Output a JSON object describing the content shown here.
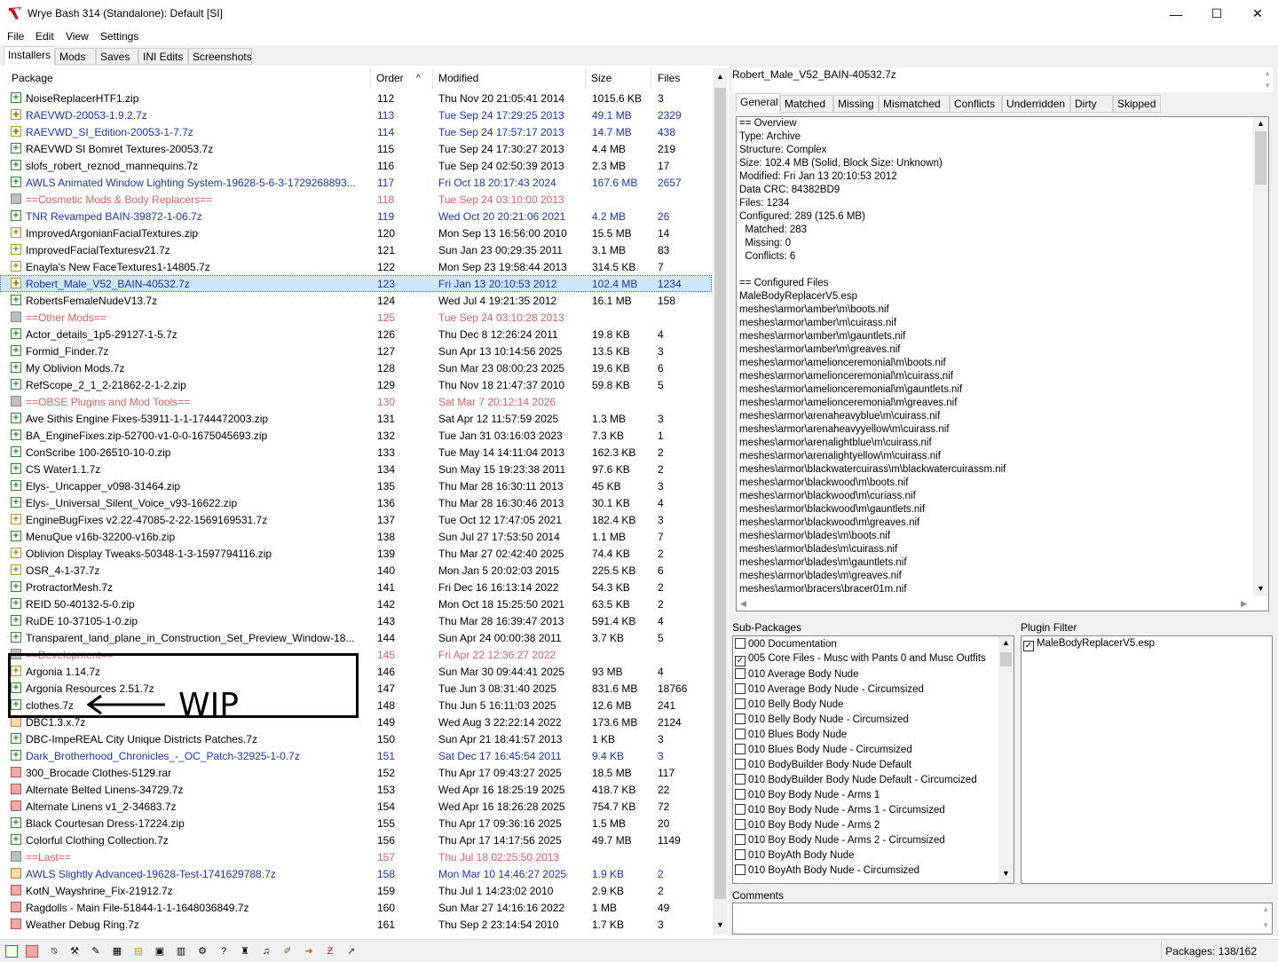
{
  "window": {
    "title": "Wrye Bash 314 (Standalone): Default [SI]",
    "minimize": "—",
    "maximize": "☐",
    "close": "✕"
  },
  "menu": [
    "File",
    "Edit",
    "View",
    "Settings"
  ],
  "tabs": [
    "Installers",
    "Mods",
    "Saves",
    "INI Edits",
    "Screenshots"
  ],
  "columns": {
    "package": "Package",
    "order": "Order",
    "modified": "Modified",
    "size": "Size",
    "files": "Files",
    "sort_arrow": "^"
  },
  "packages": [
    {
      "name": "NoiseReplacerHTF1.zip",
      "order": "112",
      "modified": "Thu Nov 20 21:05:41 2014",
      "size": "1015.6 KB",
      "files": "3",
      "icon": "green",
      "style": ""
    },
    {
      "name": "RAEVWD-20053-1.9.2.7z",
      "order": "113",
      "modified": "Tue Sep 24 17:29:25 2013",
      "size": "49.1 MB",
      "files": "2329",
      "icon": "yellowx",
      "style": "blue"
    },
    {
      "name": "RAEVWD_SI_Edition-20053-1-7.7z",
      "order": "114",
      "modified": "Tue Sep 24 17:57:17 2013",
      "size": "14.7 MB",
      "files": "438",
      "icon": "yellowx",
      "style": "blue"
    },
    {
      "name": "RAEVWD SI Bomret Textures-20053.7z",
      "order": "115",
      "modified": "Tue Sep 24 17:30:27 2013",
      "size": "4.4 MB",
      "files": "219",
      "icon": "green",
      "style": ""
    },
    {
      "name": "slofs_robert_reznod_mannequins.7z",
      "order": "116",
      "modified": "Tue Sep 24 02:50:39 2013",
      "size": "2.3 MB",
      "files": "17",
      "icon": "green",
      "style": ""
    },
    {
      "name": "AWLS Animated Window Lighting System-19628-5-6-3-1729268893...",
      "order": "117",
      "modified": "Fri Oct 18 20:17:43 2024",
      "size": "167.6 MB",
      "files": "2657",
      "icon": "green",
      "style": "blue"
    },
    {
      "name": "==Cosmetic Mods & Body Replacers==",
      "order": "118",
      "modified": "Tue Sep 24 03:10:00 2013",
      "size": "",
      "files": "",
      "icon": "gray",
      "style": "redt"
    },
    {
      "name": "TNR Revamped BAIN-39872-1-06.7z",
      "order": "119",
      "modified": "Wed Oct 20 20:21:06 2021",
      "size": "4.2 MB",
      "files": "26",
      "icon": "green",
      "style": "blue"
    },
    {
      "name": "ImprovedArgonianFacialTextures.zip",
      "order": "120",
      "modified": "Mon Sep 13 16:56:00 2010",
      "size": "15.5 MB",
      "files": "14",
      "icon": "yellow",
      "style": ""
    },
    {
      "name": "ImprovedFacialTexturesv21.7z",
      "order": "121",
      "modified": "Sun Jan 23 00:29:35 2011",
      "size": "3.1 MB",
      "files": "83",
      "icon": "yellow",
      "style": ""
    },
    {
      "name": "Enayla's New FaceTextures1-14805.7z",
      "order": "122",
      "modified": "Mon Sep 23 19:58:44 2013",
      "size": "314.5 KB",
      "files": "7",
      "icon": "yellow",
      "style": ""
    },
    {
      "name": "Robert_Male_V52_BAIN-40532.7z",
      "order": "123",
      "modified": "Fri Jan 13 20:10:53 2012",
      "size": "102.4 MB",
      "files": "1234",
      "icon": "yellowx",
      "style": "blue",
      "selected": true
    },
    {
      "name": "RobertsFemaleNudeV13.7z",
      "order": "124",
      "modified": "Wed Jul  4 19:21:35 2012",
      "size": "16.1 MB",
      "files": "158",
      "icon": "green",
      "style": ""
    },
    {
      "name": "==Other Mods==",
      "order": "125",
      "modified": "Tue Sep 24 03:10:28 2013",
      "size": "",
      "files": "",
      "icon": "gray",
      "style": "redt"
    },
    {
      "name": "Actor_details_1p5-29127-1-5.7z",
      "order": "126",
      "modified": "Thu Dec  8 12:26:24 2011",
      "size": "19.8 KB",
      "files": "4",
      "icon": "green",
      "style": ""
    },
    {
      "name": "Formid_Finder.7z",
      "order": "127",
      "modified": "Sun Apr 13 10:14:56 2025",
      "size": "13.5 KB",
      "files": "3",
      "icon": "green",
      "style": ""
    },
    {
      "name": "My Oblivion Mods.7z",
      "order": "128",
      "modified": "Sun Mar 23 08:00:23 2025",
      "size": "19.6 KB",
      "files": "6",
      "icon": "green",
      "style": ""
    },
    {
      "name": "RefScope_2_1_2-21862-2-1-2.zip",
      "order": "129",
      "modified": "Thu Nov 18 21:47:37 2010",
      "size": "59.8 KB",
      "files": "5",
      "icon": "green",
      "style": ""
    },
    {
      "name": "==OBSE Plugins and Mod Tools==",
      "order": "130",
      "modified": "Sat Mar  7 20:12:14 2026",
      "size": "",
      "files": "",
      "icon": "gray",
      "style": "redt"
    },
    {
      "name": "Ave Sithis Engine Fixes-53911-1-1-1744472003.zip",
      "order": "131",
      "modified": "Sat Apr 12 11:57:59 2025",
      "size": "1.3 MB",
      "files": "3",
      "icon": "green",
      "style": ""
    },
    {
      "name": "BA_EngineFixes.zip-52700-v1-0-0-1675045693.zip",
      "order": "132",
      "modified": "Tue Jan 31 03:16:03 2023",
      "size": "7.3 KB",
      "files": "1",
      "icon": "green",
      "style": ""
    },
    {
      "name": "ConScribe 100-26510-10-0.zip",
      "order": "133",
      "modified": "Tue May 14 14:11:04 2013",
      "size": "162.3 KB",
      "files": "2",
      "icon": "green",
      "style": ""
    },
    {
      "name": "CS Water1.1.7z",
      "order": "134",
      "modified": "Sun May 15 19:23:38 2011",
      "size": "97.6 KB",
      "files": "2",
      "icon": "green",
      "style": ""
    },
    {
      "name": "Elys-_Uncapper_v098-31464.zip",
      "order": "135",
      "modified": "Thu Mar 28 16:30:11 2013",
      "size": "45 KB",
      "files": "3",
      "icon": "green",
      "style": ""
    },
    {
      "name": "Elys-_Universal_Silent_Voice_v93-16622.zip",
      "order": "136",
      "modified": "Thu Mar 28 16:30:46 2013",
      "size": "30.1 KB",
      "files": "4",
      "icon": "green",
      "style": ""
    },
    {
      "name": "EngineBugFixes v2.22-47085-2-22-1569169531.7z",
      "order": "137",
      "modified": "Tue Oct 12 17:47:05 2021",
      "size": "182.4 KB",
      "files": "3",
      "icon": "yellow",
      "style": ""
    },
    {
      "name": "MenuQue v16b-32200-v16b.zip",
      "order": "138",
      "modified": "Sun Jul 27 17:53:50 2014",
      "size": "1.1 MB",
      "files": "7",
      "icon": "green",
      "style": ""
    },
    {
      "name": "Oblivion Display Tweaks-50348-1-3-1597794116.zip",
      "order": "139",
      "modified": "Thu Mar 27 02:42:40 2025",
      "size": "74.4 KB",
      "files": "2",
      "icon": "yellow",
      "style": ""
    },
    {
      "name": "OSR_4-1-37.7z",
      "order": "140",
      "modified": "Mon Jan  5 20:02:03 2015",
      "size": "225.5 KB",
      "files": "6",
      "icon": "yellow",
      "style": ""
    },
    {
      "name": "ProtractorMesh.7z",
      "order": "141",
      "modified": "Fri Dec 16 16:13:14 2022",
      "size": "54.3 KB",
      "files": "2",
      "icon": "green",
      "style": ""
    },
    {
      "name": "REID 50-40132-5-0.zip",
      "order": "142",
      "modified": "Mon Oct 18 15:25:50 2021",
      "size": "63.5 KB",
      "files": "2",
      "icon": "green",
      "style": ""
    },
    {
      "name": "RuDE 10-37105-1-0.zip",
      "order": "143",
      "modified": "Thu Mar 28 16:39:47 2013",
      "size": "591.4 KB",
      "files": "4",
      "icon": "green",
      "style": ""
    },
    {
      "name": "Transparent_land_plane_in_Construction_Set_Preview_Window-18...",
      "order": "144",
      "modified": "Sun Apr 24 00:00:38 2011",
      "size": "3.7 KB",
      "files": "5",
      "icon": "green",
      "style": ""
    },
    {
      "name": "==Development==",
      "order": "145",
      "modified": "Fri Apr 22 12:36:27 2022",
      "size": "",
      "files": "",
      "icon": "gray",
      "style": "redt"
    },
    {
      "name": "Argonia 1.14.7z",
      "order": "146",
      "modified": "Sun Mar 30 09:44:41 2025",
      "size": "93 MB",
      "files": "4",
      "icon": "yellow",
      "style": ""
    },
    {
      "name": "Argonia Resources 2.51.7z",
      "order": "147",
      "modified": "Tue Jun  3 08:31:40 2025",
      "size": "831.6 MB",
      "files": "18766",
      "icon": "green",
      "style": ""
    },
    {
      "name": "clothes.7z",
      "order": "148",
      "modified": "Thu Jun  5 16:11:03 2025",
      "size": "12.6 MB",
      "files": "241",
      "icon": "green",
      "style": ""
    },
    {
      "name": "DBC1.3.x.7z",
      "order": "149",
      "modified": "Wed Aug  3 22:22:14 2022",
      "size": "173.6 MB",
      "files": "2124",
      "icon": "orange",
      "style": ""
    },
    {
      "name": "DBC-ImpeREAL City Unique Districts Patches.7z",
      "order": "150",
      "modified": "Sun Apr 21 18:41:57 2013",
      "size": "1 KB",
      "files": "3",
      "icon": "green",
      "style": ""
    },
    {
      "name": "Dark_Brotherhood_Chronicles_-_OC_Patch-32925-1-0.7z",
      "order": "151",
      "modified": "Sat Dec 17 16:45:54 2011",
      "size": "9.4 KB",
      "files": "3",
      "icon": "green",
      "style": "blue"
    },
    {
      "name": "300_Brocade Clothes-5129.rar",
      "order": "152",
      "modified": "Thu Apr 17 09:43:27 2025",
      "size": "18.5 MB",
      "files": "117",
      "icon": "red",
      "style": ""
    },
    {
      "name": "Alternate Belted Linens-34729.7z",
      "order": "153",
      "modified": "Wed Apr 16 18:25:19 2025",
      "size": "418.7 KB",
      "files": "22",
      "icon": "red",
      "style": ""
    },
    {
      "name": "Alternate Linens v1_2-34683.7z",
      "order": "154",
      "modified": "Wed Apr 16 18:26:28 2025",
      "size": "754.7 KB",
      "files": "72",
      "icon": "red",
      "style": ""
    },
    {
      "name": "Black Courtesan Dress-17224.zip",
      "order": "155",
      "modified": "Thu Apr 17 09:36:16 2025",
      "size": "1.5 MB",
      "files": "20",
      "icon": "green",
      "style": ""
    },
    {
      "name": "Colorful Clothing Collection.7z",
      "order": "156",
      "modified": "Thu Apr 17 14:17:56 2025",
      "size": "49.7 MB",
      "files": "1149",
      "icon": "green",
      "style": ""
    },
    {
      "name": "==Last==",
      "order": "157",
      "modified": "Thu Jul 18 02:25:50 2013",
      "size": "",
      "files": "",
      "icon": "gray",
      "style": "redt"
    },
    {
      "name": "AWLS Slightly Advanced-19628-Test-1741629788.7z",
      "order": "158",
      "modified": "Mon Mar 10 14:46:27 2025",
      "size": "1.9 KB",
      "files": "2",
      "icon": "orange",
      "style": "blue"
    },
    {
      "name": "KotN_Wayshrine_Fix-21912.7z",
      "order": "159",
      "modified": "Thu Jul  1 14:23:02 2010",
      "size": "2.9 KB",
      "files": "2",
      "icon": "red",
      "style": ""
    },
    {
      "name": "Ragdolls - Main File-51844-1-1-1648036849.7z",
      "order": "160",
      "modified": "Sun Mar 27 14:16:16 2022",
      "size": "1 MB",
      "files": "49",
      "icon": "red",
      "style": ""
    },
    {
      "name": "Weather Debug Ring.7z",
      "order": "161",
      "modified": "Thu Sep  2 23:14:54 2010",
      "size": "1.7 KB",
      "files": "3",
      "icon": "red",
      "style": ""
    }
  ],
  "annotation": {
    "text": "WIP"
  },
  "details": {
    "package_name": "Robert_Male_V52_BAIN-40532.7z",
    "tabs": [
      "General",
      "Matched",
      "Missing",
      "Mismatched",
      "Conflicts",
      "Underridden",
      "Dirty",
      "Skipped"
    ],
    "info_lines": [
      "== Overview",
      "Type: Archive",
      "Structure: Complex",
      "Size: 102.4 MB (Solid, Block Size: Unknown)",
      "Modified: Fri Jan 13 20:10:53 2012",
      "Data CRC: 84382BD9",
      "Files: 1234",
      "Configured: 289 (125.6 MB)",
      "  Matched: 283",
      "  Missing: 0",
      "  Conflicts: 6",
      "",
      "== Configured Files",
      "MaleBodyReplacerV5.esp",
      "meshes\\armor\\amber\\m\\boots.nif",
      "meshes\\armor\\amber\\m\\cuirass.nif",
      "meshes\\armor\\amber\\m\\gauntlets.nif",
      "meshes\\armor\\amber\\m\\greaves.nif",
      "meshes\\armor\\amelionceremonial\\m\\boots.nif",
      "meshes\\armor\\amelionceremonial\\m\\cuirass.nif",
      "meshes\\armor\\amelionceremonial\\m\\gauntlets.nif",
      "meshes\\armor\\amelionceremonial\\m\\greaves.nif",
      "meshes\\armor\\arenaheavyblue\\m\\cuirass.nif",
      "meshes\\armor\\arenaheavyyellow\\m\\cuirass.nif",
      "meshes\\armor\\arenalightblue\\m\\cuirass.nif",
      "meshes\\armor\\arenalightyellow\\m\\cuirass.nif",
      "meshes\\armor\\blackwatercuirass\\m\\blackwatercuirassm.nif",
      "meshes\\armor\\blackwood\\m\\boots.nif",
      "meshes\\armor\\blackwood\\m\\curiass.nif",
      "meshes\\armor\\blackwood\\m\\gauntlets.nif",
      "meshes\\armor\\blackwood\\m\\greaves.nif",
      "meshes\\armor\\blades\\m\\boots.nif",
      "meshes\\armor\\blades\\m\\cuirass.nif",
      "meshes\\armor\\blades\\m\\gauntlets.nif",
      "meshes\\armor\\blades\\m\\greaves.nif",
      "meshes\\armor\\bracers\\bracer01m.nif"
    ]
  },
  "subpackages": {
    "label": "Sub-Packages",
    "items": [
      {
        "label": "000 Documentation",
        "checked": false
      },
      {
        "label": "005 Core Files - Musc with Pants 0 and Musc Outfits",
        "checked": true
      },
      {
        "label": "010 Average Body Nude",
        "checked": false
      },
      {
        "label": "010 Average Body Nude - Circumsized",
        "checked": false
      },
      {
        "label": "010 Belly Body Nude",
        "checked": false
      },
      {
        "label": "010 Belly Body Nude - Circumsized",
        "checked": false
      },
      {
        "label": "010 Blues Body Nude",
        "checked": false
      },
      {
        "label": "010 Blues Body Nude - Circumsized",
        "checked": false
      },
      {
        "label": "010 BodyBuilder Body Nude Default",
        "checked": false
      },
      {
        "label": "010 BodyBuilder Body Nude Default - Circumcized",
        "checked": false
      },
      {
        "label": "010 Boy Body Nude - Arms 1",
        "checked": false
      },
      {
        "label": "010 Boy Body Nude - Arms 1 - Circumsized",
        "checked": false
      },
      {
        "label": "010 Boy Body Nude - Arms 2",
        "checked": false
      },
      {
        "label": "010 Boy Body Nude - Arms 2 - Circumsized",
        "checked": false
      },
      {
        "label": "010 BoyAth Body Nude",
        "checked": false
      },
      {
        "label": "010 BoyAth Body Nude - Circumsized",
        "checked": false
      }
    ]
  },
  "plugin_filter": {
    "label": "Plugin Filter",
    "items": [
      {
        "label": "MaleBodyReplacerV5.esp",
        "checked": true
      }
    ]
  },
  "comments": {
    "label": "Comments"
  },
  "status": {
    "packages": "Packages: 138/162"
  }
}
